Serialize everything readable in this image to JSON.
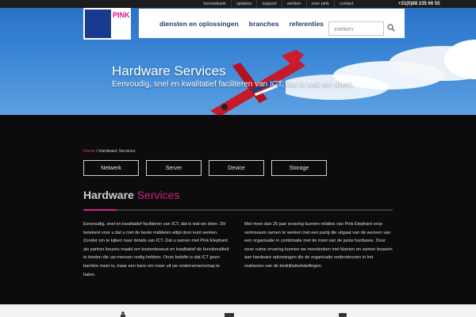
{
  "topbar": {
    "links": [
      "kennisbank",
      "updates",
      "support",
      "werken",
      "over pink",
      "contact"
    ],
    "phone": "+31(0)88 235 66 55"
  },
  "logo": {
    "text": "PINK"
  },
  "nav": {
    "items": [
      "diensten en oplossingen",
      "branches",
      "referenties"
    ]
  },
  "search": {
    "placeholder": "zoeken"
  },
  "hero": {
    "title": "Hardware Services",
    "subtitle": "Eenvoudig, snel en kwalitatief faciliteren van ICT, dat is wat we doen."
  },
  "breadcrumb": {
    "home": "Home",
    "separator": "/",
    "current": "Hardware Services"
  },
  "categories": [
    "Netwerk",
    "Server",
    "Device",
    "Storage"
  ],
  "section": {
    "title_white": "Hardware",
    "title_pink": "Services"
  },
  "content": {
    "left": "Eenvoudig, snel en kwalitatief faciliteren van ICT, dat is wat we doen. Dit betekent voor u dat u met de beste middelen altijd door kunt werken. Zonder om te kijken naar details van ICT. Dat u samen met Pink Elephant als partner keuzes maakt om kostenbewust en kwalitatief de functionaliteit te bieden die uw mensen nodig hebben. Onze belofte is dat ICT geen barrière meer is, maar een kans om meer uit uw ondernemerschap te halen.",
    "right": "Met meer dan 25 jaar ervaring kunnen relaties van Pink Elephant erop vertrouwen samen te werken met een partij die uitgaat van de wensen van een organisatie in combinatie met de inzet van de juiste hardware. Door onze ruime ervaring kunnen we meedenken met klanten en samen bouwen aan hardware oplossingen die de organisatie ondersteunen in het realiseren van de bedrijfsdoelstellingen."
  },
  "colors": {
    "accent": "#d21f85",
    "navText": "#1f3f6d",
    "background": "#0c0c0c"
  }
}
